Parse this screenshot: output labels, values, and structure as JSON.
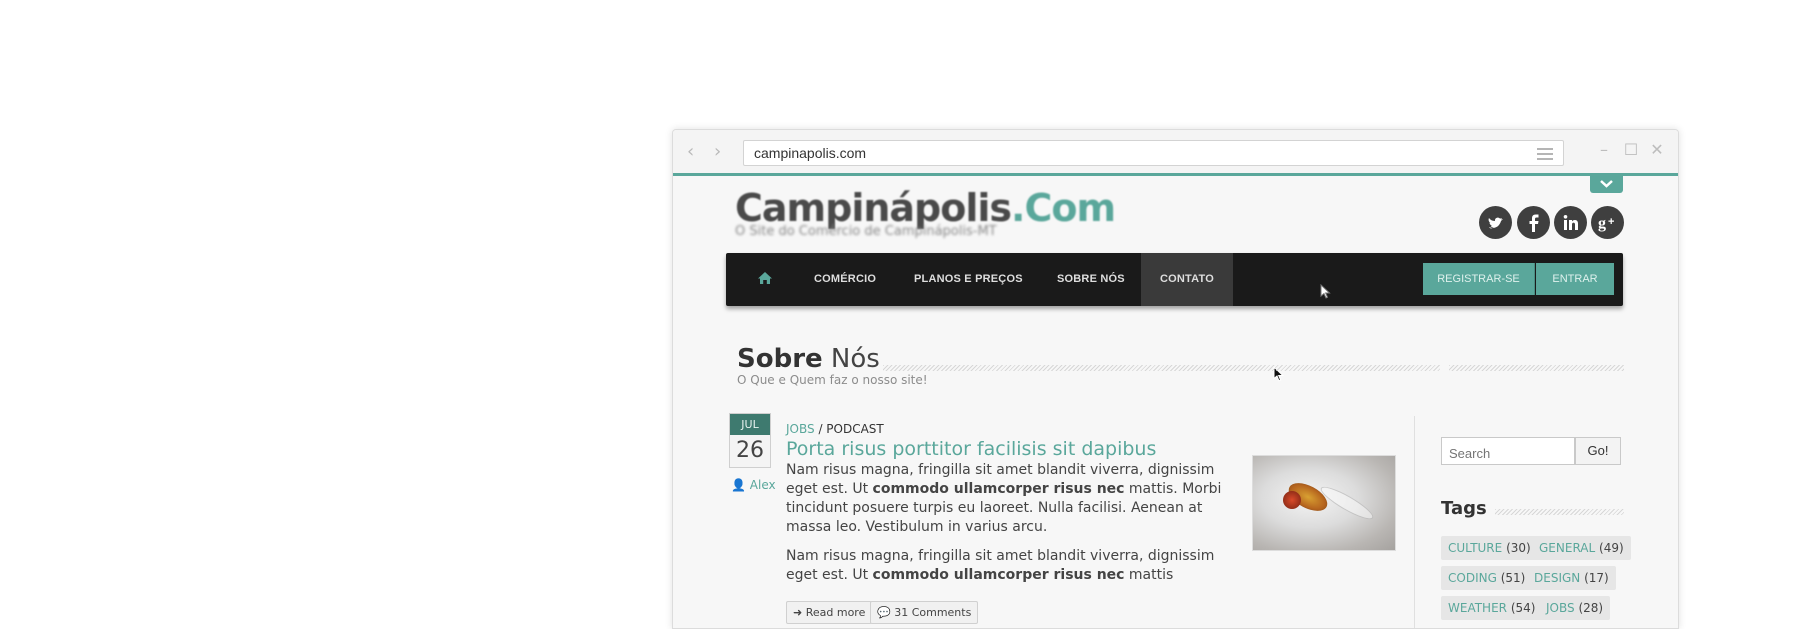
{
  "browser": {
    "url": "campinapolis.com"
  },
  "site": {
    "logo_main": "Campinápolis",
    "logo_suffix": ".Com",
    "tagline": "O Site do Comércio de Campinápolis-MT"
  },
  "social": [
    "twitter",
    "facebook",
    "linkedin",
    "google-plus"
  ],
  "nav": {
    "items": [
      "COMÉRCIO",
      "PLANOS E PREÇOS",
      "SOBRE NÓS",
      "CONTATO"
    ],
    "active": "CONTATO",
    "register": "REGISTRAR-SE",
    "login": "ENTRAR"
  },
  "section": {
    "title_bold": "Sobre",
    "title_rest": " Nós",
    "subtitle": "O Que e Quem faz o nosso site!"
  },
  "post": {
    "month": "JUL",
    "day": "26",
    "author": "Alex",
    "cat1": "JOBS",
    "sep": " / ",
    "cat2": "PODCAST",
    "title": "Porta risus porttitor facilisis sit dapibus",
    "p1_a": "Nam risus magna, fringilla sit amet blandit viverra, dignissim eget est. Ut ",
    "p1_b": "commodo ullamcorper risus nec",
    "p1_c": " mattis. Morbi tincidunt posuere turpis eu laoreet. Nulla facilisi. Aenean at massa leo. Vestibulum in varius arcu.",
    "p2_a": "Nam risus magna, fringilla sit amet blandit viverra, dignissim eget est. Ut ",
    "p2_b": "commodo ullamcorper risus nec",
    "p2_c": " mattis",
    "read_more": "Read more",
    "comments": "31 Comments"
  },
  "sidebar": {
    "search_placeholder": "Search",
    "search_button": "Go!",
    "tags_title": "Tags",
    "tags": [
      {
        "name": "CULTURE",
        "count": "(30)"
      },
      {
        "name": "GENERAL",
        "count": "(49)"
      },
      {
        "name": "CODING",
        "count": "(51)"
      },
      {
        "name": "DESIGN",
        "count": "(17)"
      },
      {
        "name": "WEATHER",
        "count": "(54)"
      },
      {
        "name": "JOBS",
        "count": "(28)"
      }
    ]
  },
  "colors": {
    "accent": "#5aa79b",
    "navbar": "#1a1a1a"
  }
}
